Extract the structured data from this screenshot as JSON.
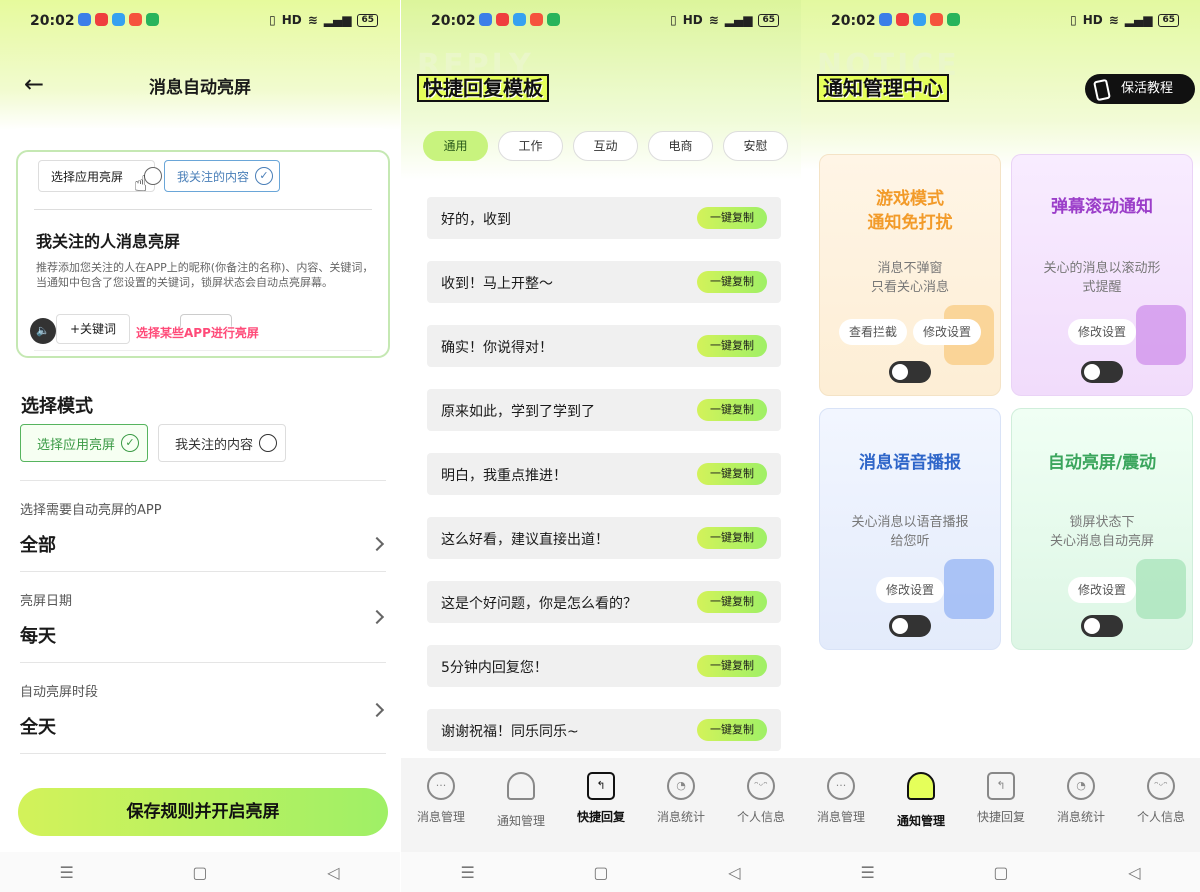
{
  "status_bar": {
    "time": "20:02",
    "battery": "65",
    "hd": "HD"
  },
  "panel1": {
    "title": "消息自动亮屏",
    "demo": {
      "option_app": "选择应用亮屏",
      "option_follow": "我关注的内容",
      "heading": "我关注的人消息亮屏",
      "description": "推荐添加您关注的人在APP上的昵称(你备注的名称)、内容、关键词，当通知中包含了您设置的关键词，锁屏状态会自动点亮屏幕。",
      "keyword_button": "+关键词",
      "annotation": "选择某些APP进行亮屏"
    },
    "mode_section": {
      "title": "选择模式",
      "options": [
        "选择应用亮屏",
        "我关注的内容"
      ],
      "selected": "选择应用亮屏"
    },
    "rows": [
      {
        "label": "选择需要自动亮屏的APP",
        "value": "全部"
      },
      {
        "label": "亮屏日期",
        "value": "每天"
      },
      {
        "label": "自动亮屏时段",
        "value": "全天"
      }
    ],
    "save_button": "保存规则并开启亮屏"
  },
  "panel2": {
    "deco_text": "REPLY",
    "title": "快捷回复模板",
    "tabs": [
      "通用",
      "工作",
      "互动",
      "电商",
      "安慰"
    ],
    "active_tab": "通用",
    "copy_label": "一键复制",
    "replies": [
      "好的，收到",
      "收到！马上开整～",
      "确实！你说得对！",
      "原来如此，学到了学到了",
      "明白，我重点推进！",
      "这么好看，建议直接出道！",
      "这是个好问题，你是怎么看的？",
      "5分钟内回复您！",
      "谢谢祝福！同乐同乐~"
    ]
  },
  "panel3": {
    "deco_text": "NOTICE",
    "title": "通知管理中心",
    "guide_button": "保活教程",
    "cards": [
      {
        "title1": "游戏模式",
        "title2": "通知免打扰",
        "desc1": "消息不弹窗",
        "desc2": "只看关心消息",
        "buttons": [
          "查看拦截",
          "修改设置"
        ],
        "color": "#f29b2a"
      },
      {
        "title1": "弹幕滚动通知",
        "title2": "",
        "desc1": "关心的消息以滚动形",
        "desc2": "式提醒",
        "buttons": [
          "修改设置"
        ],
        "color": "#9b3ec9"
      },
      {
        "title1": "消息语音播报",
        "title2": "",
        "desc1": "关心消息以语音播报",
        "desc2": "给您听",
        "buttons": [
          "修改设置"
        ],
        "color": "#2f66c9"
      },
      {
        "title1": "自动亮屏/震动",
        "title2": "",
        "desc1": "锁屏状态下",
        "desc2": "关心消息自动亮屏",
        "buttons": [
          "修改设置"
        ],
        "color": "#3aa55c"
      }
    ]
  },
  "bottom_nav": [
    "消息管理",
    "通知管理",
    "快捷回复",
    "消息统计",
    "个人信息"
  ],
  "nav_icons": [
    "chat-icon",
    "bell-icon",
    "quick-reply-icon",
    "pie-chart-icon",
    "smile-icon"
  ]
}
